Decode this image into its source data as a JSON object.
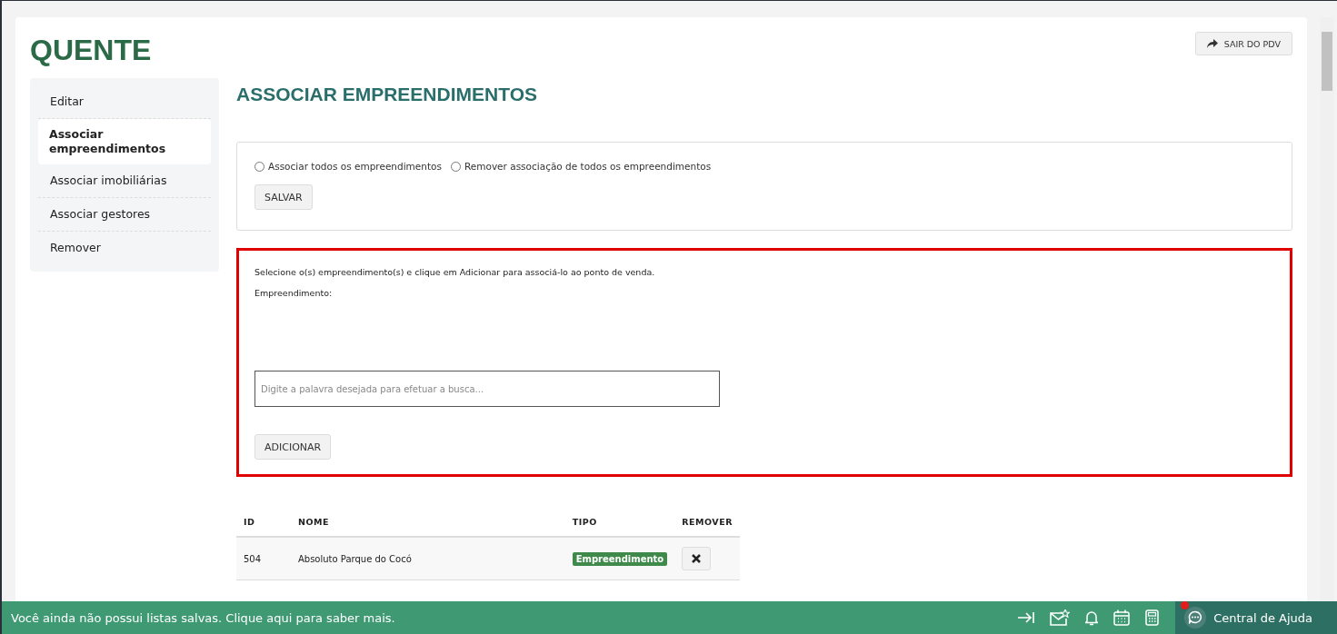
{
  "header": {
    "title": "QUENTE",
    "exit_button": "SAIR DO PDV"
  },
  "sidebar": {
    "items": [
      {
        "label": "Editar",
        "selected": false
      },
      {
        "label": "Associar empreendimentos",
        "selected": true
      },
      {
        "label": "Associar imobiliárias",
        "selected": false
      },
      {
        "label": "Associar gestores",
        "selected": false
      },
      {
        "label": "Remover",
        "selected": false
      }
    ]
  },
  "page_title": "ASSOCIAR EMPREENDIMENTOS",
  "bulk_panel": {
    "options": [
      {
        "label": "Associar todos os empreendimentos",
        "checked": false
      },
      {
        "label": "Remover associação de todos os empreendimentos",
        "checked": false
      }
    ],
    "save_button": "SALVAR"
  },
  "add_panel": {
    "instruction": "Selecione o(s) empreendimento(s) e clique em Adicionar para associá-lo ao ponto de venda.",
    "field_label": "Empreendimento:",
    "search": {
      "placeholder": "Digite a palavra desejada para efetuar a busca..."
    },
    "add_button": "ADICIONAR"
  },
  "table": {
    "columns": [
      "ID",
      "NOME",
      "TIPO",
      "REMOVER"
    ],
    "rows": [
      {
        "id": "504",
        "nome": "Absoluto Parque do Cocó",
        "tipo": "Empreendimento"
      }
    ]
  },
  "bottom_bar": {
    "message": "Você ainda não possui listas salvas. Clique aqui para saber mais.",
    "help_button": "Central de Ajuda",
    "help_notification": true
  }
}
